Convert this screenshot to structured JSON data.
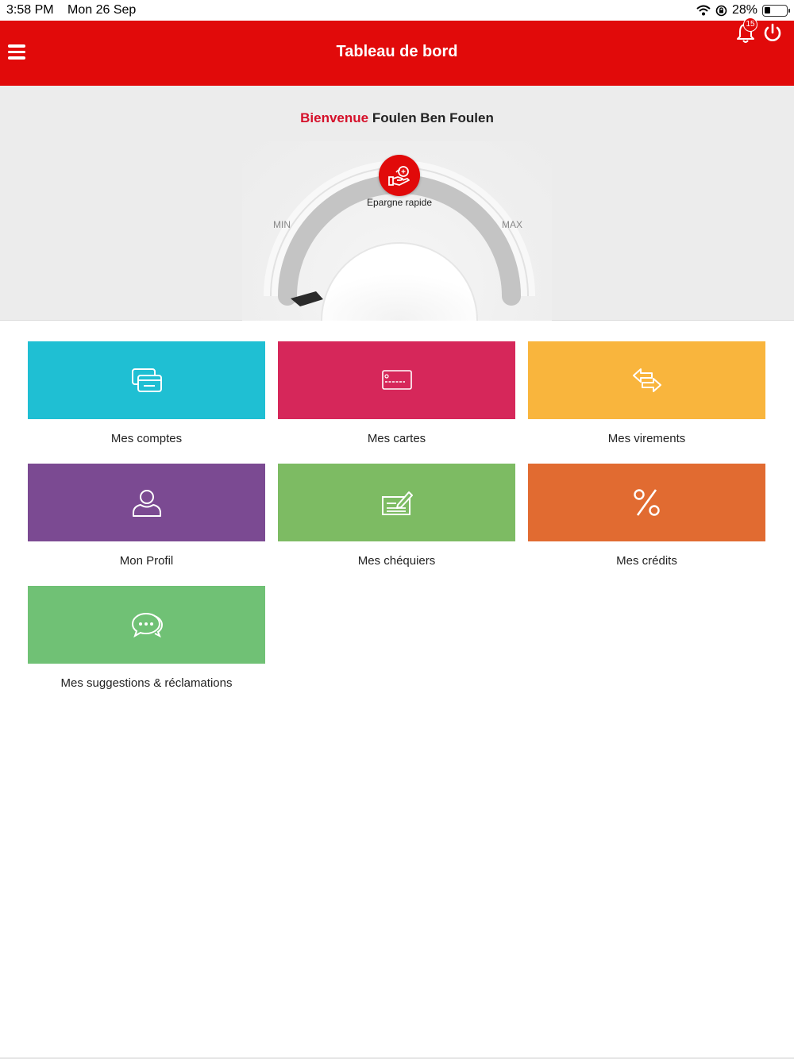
{
  "status_bar": {
    "time": "3:58 PM",
    "date": "Mon 26 Sep",
    "battery": "28%",
    "battery_level": 0.28
  },
  "header": {
    "title": "Tableau de bord",
    "notification_count": "15"
  },
  "welcome": {
    "greeting": "Bienvenue",
    "name": "Foulen Ben Foulen"
  },
  "gauge": {
    "action_label": "Epargne rapide",
    "min_label": "MIN",
    "max_label": "MAX",
    "level": 0
  },
  "tiles": [
    {
      "label": "Mes comptes",
      "color": "#1fbfd3",
      "icon": "accounts-icon"
    },
    {
      "label": "Mes cartes",
      "color": "#d6275a",
      "icon": "card-icon"
    },
    {
      "label": "Mes virements",
      "color": "#f9b53d",
      "icon": "transfer-icon"
    },
    {
      "label": "Mon Profil",
      "color": "#7b4a92",
      "icon": "user-icon"
    },
    {
      "label": "Mes chéquiers",
      "color": "#7dbb63",
      "icon": "checkbook-icon"
    },
    {
      "label": "Mes crédits",
      "color": "#e16b31",
      "icon": "percent-icon"
    },
    {
      "label": "Mes suggestions & réclamations",
      "color": "#70c175",
      "icon": "chat-icon"
    }
  ],
  "colors": {
    "brand_red": "#e10a0a",
    "greeting_red": "#d5102a"
  }
}
